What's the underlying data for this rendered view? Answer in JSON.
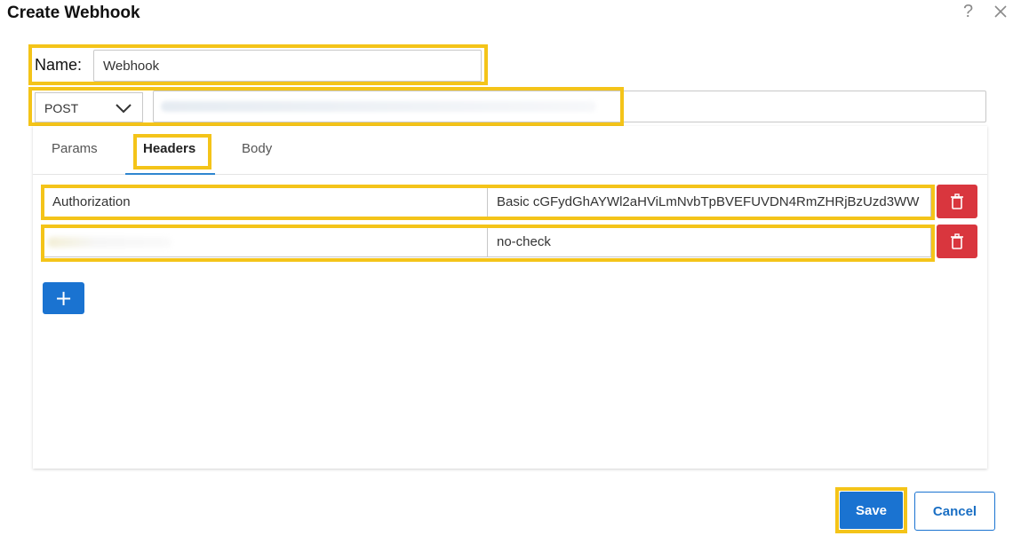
{
  "dialog": {
    "title": "Create Webhook",
    "help_glyph": "?",
    "icons": {
      "help": "help-icon",
      "close": "close-icon"
    }
  },
  "name_field": {
    "label": "Name:",
    "value": "Webhook"
  },
  "request": {
    "method": "POST",
    "url": ""
  },
  "tabs": [
    {
      "label": "Params",
      "active": false
    },
    {
      "label": "Headers",
      "active": true
    },
    {
      "label": "Body",
      "active": false
    }
  ],
  "headers": [
    {
      "key": "Authorization",
      "value": "Basic cGFydGhAYWl2aHViLmNvbTpBVEFUVDN4RmZHRjBzUzd3WW"
    },
    {
      "key": "",
      "value": "no-check"
    }
  ],
  "add_button": {
    "label": "+",
    "icon": "plus-icon"
  },
  "footer": {
    "save_label": "Save",
    "cancel_label": "Cancel"
  },
  "colors": {
    "highlight": "#f4c419",
    "primary": "#1a73d1",
    "danger": "#d9363e",
    "tab_underline": "#2f86d0"
  }
}
